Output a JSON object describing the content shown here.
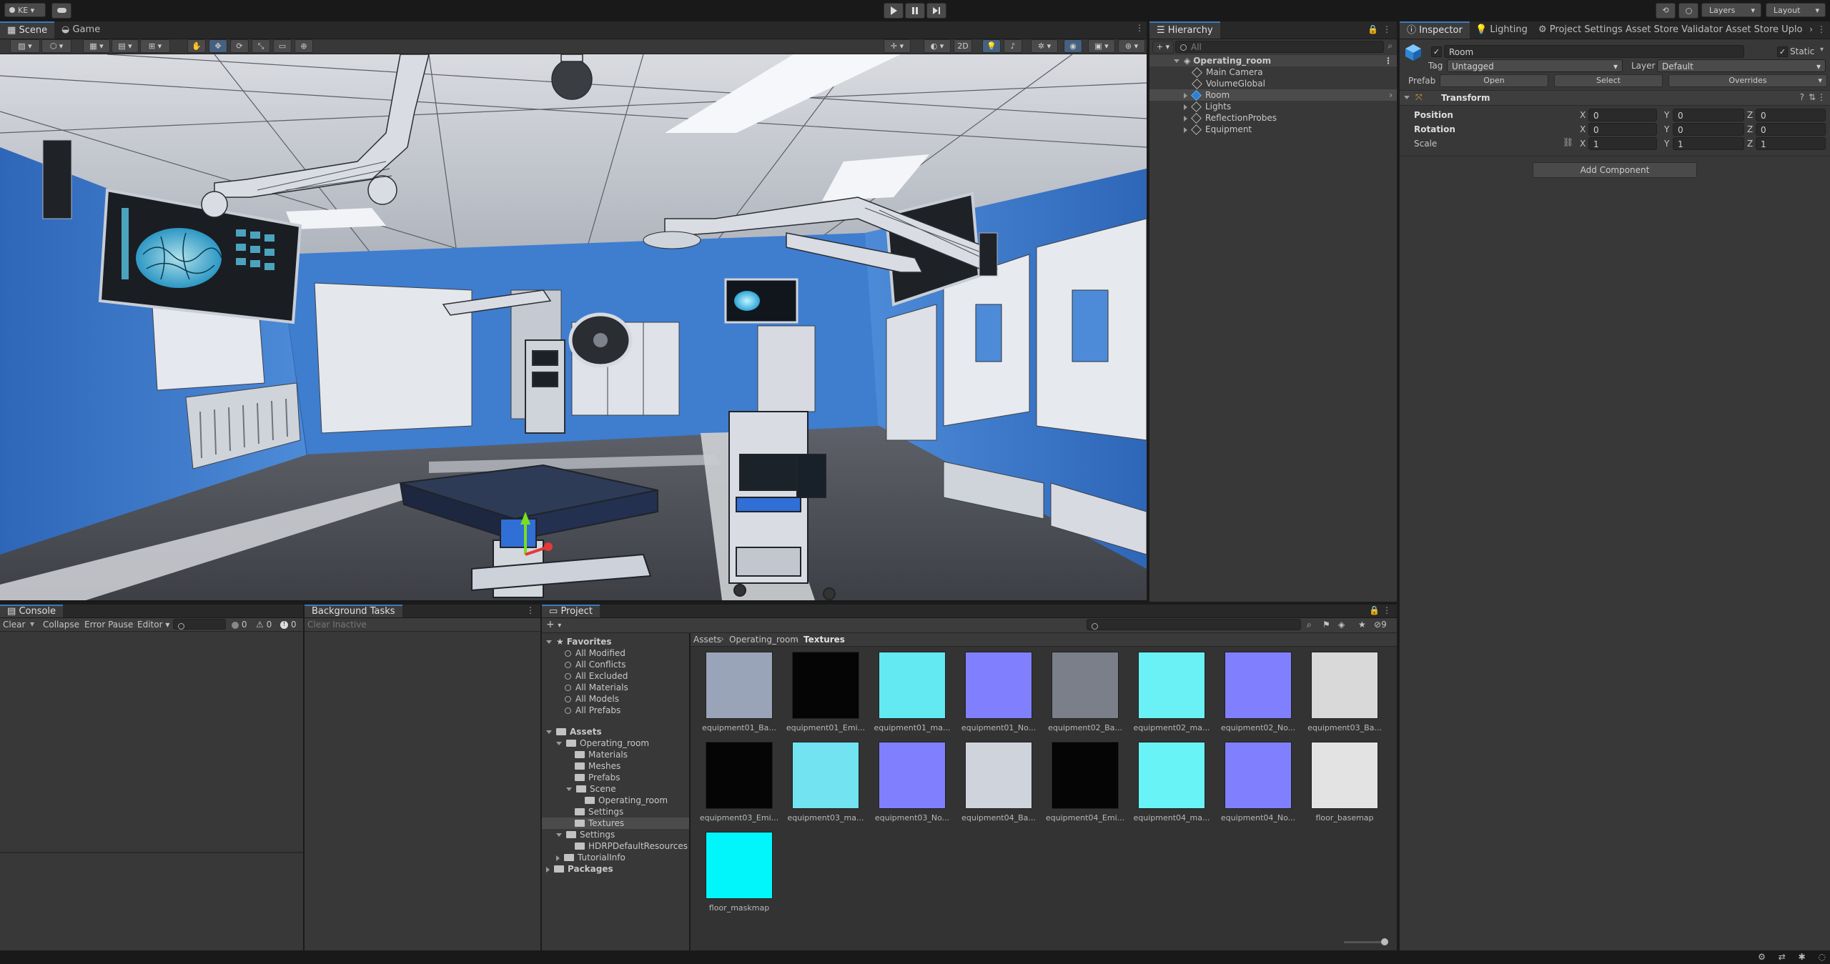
{
  "topbar": {
    "account": "KE",
    "layers": "Layers",
    "layout": "Layout"
  },
  "scene_tabs": [
    "Scene",
    "Game"
  ],
  "scene_toolbar": {
    "mode_2d": "2D"
  },
  "hierarchy": {
    "title": "Hierarchy",
    "search_placeholder": "All",
    "root": "Operating_room",
    "items": [
      "Main Camera",
      "VolumeGlobal",
      "Room",
      "Lights",
      "ReflectionProbes",
      "Equipment"
    ]
  },
  "inspector": {
    "tabs": [
      "Inspector",
      "Lighting",
      "Project Settings",
      "Asset Store Validator",
      "Asset Store Uplo"
    ],
    "object_name": "Room",
    "static_label": "Static",
    "tag_label": "Tag",
    "tag_value": "Untagged",
    "layer_label": "Layer",
    "layer_value": "Default",
    "prefab_label": "Prefab",
    "prefab_open": "Open",
    "prefab_select": "Select",
    "prefab_overrides": "Overrides",
    "transform_title": "Transform",
    "rows": [
      {
        "label": "Position",
        "x": "0",
        "y": "0",
        "z": "0"
      },
      {
        "label": "Rotation",
        "x": "0",
        "y": "0",
        "z": "0"
      },
      {
        "label": "Scale",
        "x": "1",
        "y": "1",
        "z": "1"
      }
    ],
    "axis_x": "X",
    "axis_y": "Y",
    "axis_z": "Z",
    "add_component": "Add Component"
  },
  "console": {
    "title": "Console",
    "clear": "Clear",
    "collapse": "Collapse",
    "error_pause": "Error Pause",
    "editor": "Editor",
    "count_log": "0",
    "count_warn": "0",
    "count_err": "0"
  },
  "background_tasks": {
    "title": "Background Tasks",
    "clear_inactive": "Clear Inactive"
  },
  "project": {
    "title": "Project",
    "hidden_count": "9",
    "favorites_label": "Favorites",
    "favorites": [
      "All Modified",
      "All Conflicts",
      "All Excluded",
      "All Materials",
      "All Models",
      "All Prefabs"
    ],
    "assets_label": "Assets",
    "tree": [
      "Operating_room",
      "Materials",
      "Meshes",
      "Prefabs",
      "Scene",
      "Operating_room",
      "Settings",
      "Textures",
      "Settings",
      "HDRPDefaultResources",
      "TutorialInfo"
    ],
    "packages_label": "Packages",
    "breadcrumb": [
      "Assets",
      "Operating_room",
      "Textures"
    ],
    "assets": [
      {
        "name": "equipment01_Ba...",
        "color": "#9aa4b8"
      },
      {
        "name": "equipment01_Emi...",
        "color": "#050505"
      },
      {
        "name": "equipment01_ma...",
        "color": "#63e9f2"
      },
      {
        "name": "equipment01_No...",
        "color": "#8080fe"
      },
      {
        "name": "equipment02_Ba...",
        "color": "#7b7f8a"
      },
      {
        "name": "equipment02_ma...",
        "color": "#69f1f5"
      },
      {
        "name": "equipment02_No...",
        "color": "#8080fe"
      },
      {
        "name": "equipment03_Ba...",
        "color": "#d9d9d9"
      },
      {
        "name": "equipment03_Emi...",
        "color": "#050505"
      },
      {
        "name": "equipment03_ma...",
        "color": "#72e3f0"
      },
      {
        "name": "equipment03_No...",
        "color": "#8080fe"
      },
      {
        "name": "equipment04_Ba...",
        "color": "#cfd3dc"
      },
      {
        "name": "equipment04_Emi...",
        "color": "#050505"
      },
      {
        "name": "equipment04_ma...",
        "color": "#68f3f6"
      },
      {
        "name": "equipment04_No...",
        "color": "#8080fe"
      },
      {
        "name": "floor_basemap",
        "color": "#e3e3e3"
      },
      {
        "name": "floor_maskmap",
        "color": "#00f6fb"
      }
    ]
  }
}
